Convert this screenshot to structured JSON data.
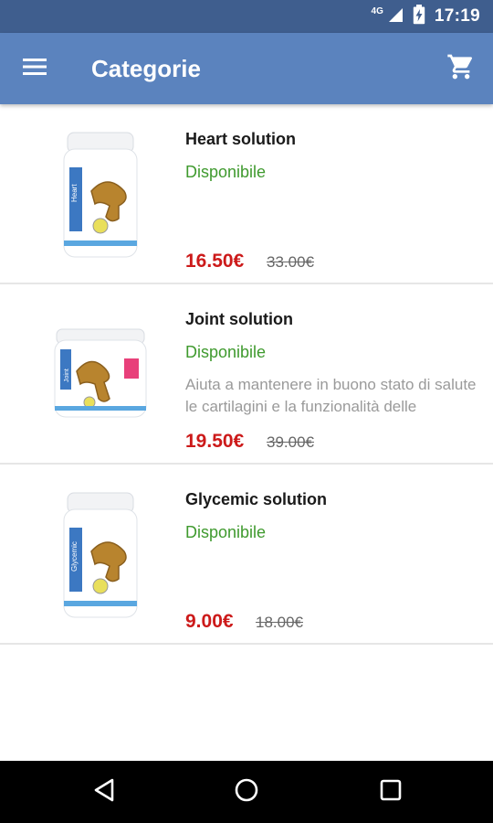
{
  "status_bar": {
    "network": "4G",
    "time": "17:19"
  },
  "app_bar": {
    "title": "Categorie",
    "menu_icon": "hamburger-menu-icon",
    "cart_icon": "shopping-cart-icon"
  },
  "products": [
    {
      "name": "Heart solution",
      "availability": "Disponibile",
      "description": "",
      "price": "16.50€",
      "old_price": "33.00€",
      "label": "Heart"
    },
    {
      "name": "Joint solution",
      "availability": "Disponibile",
      "description": "Aiuta a mantenere in buono stato di salute le cartilagini e la funzionalità delle",
      "price": "19.50€",
      "old_price": "39.00€",
      "label": "Joint"
    },
    {
      "name": "Glycemic solution",
      "availability": "Disponibile",
      "description": "",
      "price": "9.00€",
      "old_price": "18.00€",
      "label": "Glycemic"
    }
  ],
  "colors": {
    "status_bar": "#3f5e8e",
    "app_bar": "#5b83be",
    "available": "#3f9a2e",
    "price": "#cc1a1a"
  }
}
